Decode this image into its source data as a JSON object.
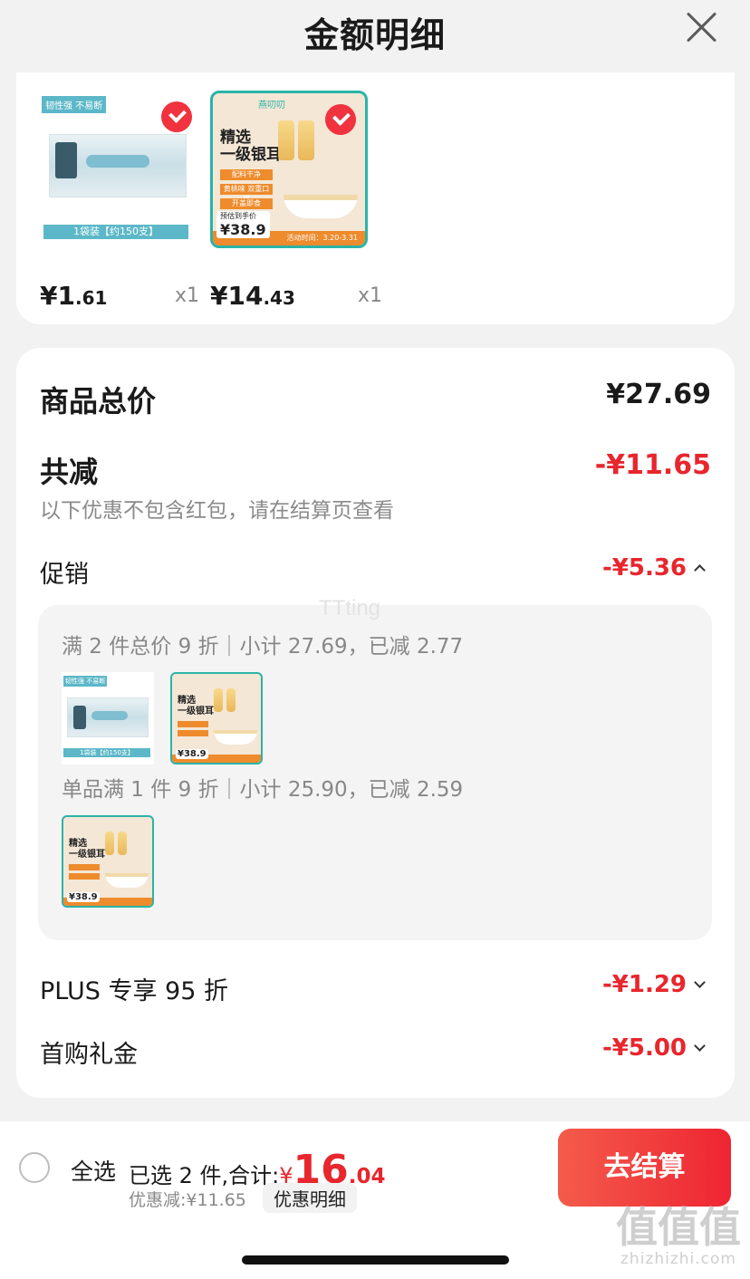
{
  "header": {
    "title": "金额明细"
  },
  "products": [
    {
      "name": "toothpick",
      "tag": "韧性强 不易断",
      "foot": "1袋装【约150支】",
      "price_main": "¥1",
      "price_cents": ".61",
      "qty": "x1",
      "selected": true
    },
    {
      "name": "tremella",
      "logo": "燕叨叨",
      "title_line1": "精选",
      "title_line2": "一级银耳",
      "bar1": "配料干净",
      "bar2": "黄桃味 双重口感",
      "bar3": "开盖即食",
      "price_tag": "38.9",
      "price_tag_prefix": "预估到手价",
      "strip": "活动时间：3.20-3.31",
      "price_main": "¥14",
      "price_cents": ".43",
      "qty": "x1",
      "selected": true
    }
  ],
  "summary": {
    "total_label": "商品总价",
    "total_value": "¥27.69",
    "reduce_label": "共减",
    "reduce_value": "-¥11.65",
    "note": "以下优惠不包含红包，请在结算页查看",
    "promo_label": "促销",
    "promo_value": "-¥5.36",
    "promo_lines": [
      "满 2 件总价 9 折｜小计 27.69，已减 2.77",
      "单品满 1 件 9 折｜小计 25.90，已减 2.59"
    ],
    "plus_label": "PLUS 专享 95 折",
    "plus_value": "-¥1.29",
    "gift_label": "首购礼金",
    "gift_value": "-¥5.00"
  },
  "watermark": "TTting",
  "bottom": {
    "select_all": "全选",
    "selected_text": "已选 2 件,合计:",
    "currency": "¥",
    "total_big": "16",
    "total_small": ".04",
    "discount_text": "优惠减:¥11.65",
    "detail_chip": "优惠明细",
    "checkout": "去结算"
  },
  "site_mark": {
    "glyphs": "值值值",
    "url": "zhizhizhi.com"
  },
  "colors": {
    "accent_red": "#e8262d",
    "checkout_gradient_start": "#f45b4b",
    "checkout_gradient_end": "#ee2532",
    "teal": "#2bb3a8"
  }
}
